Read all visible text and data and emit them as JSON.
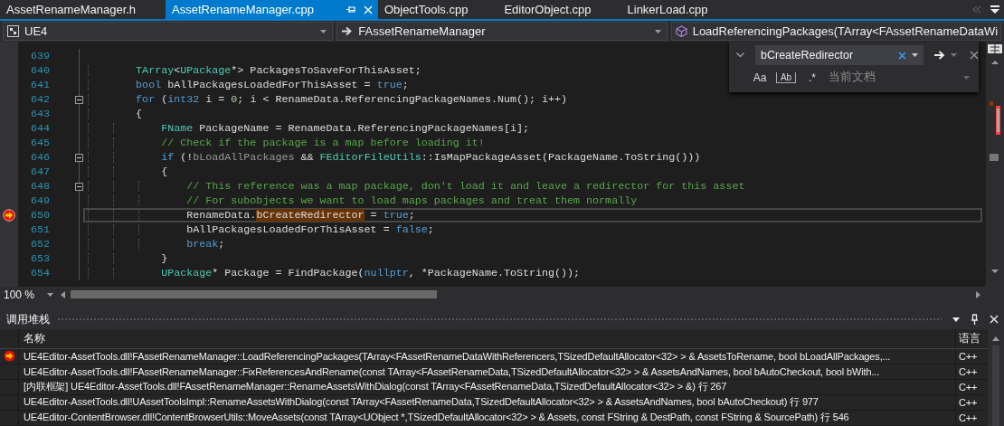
{
  "tabs": [
    {
      "label": "AssetRenameManager.h",
      "selected": false
    },
    {
      "label": "AssetRenameManager.cpp",
      "selected": true
    },
    {
      "label": "ObjectTools.cpp",
      "selected": false
    },
    {
      "label": "EditorObject.cpp",
      "selected": false
    },
    {
      "label": "LinkerLoad.cpp",
      "selected": false
    }
  ],
  "navigation": {
    "project": "UE4",
    "scope": "FAssetRenameManager",
    "member": "LoadReferencingPackages(TArray<FAssetRenameDataWi"
  },
  "find": {
    "value": "bCreateRedirector",
    "scope": "当前文档",
    "options": [
      {
        "kind": "case",
        "label": "Aa",
        "on": false
      },
      {
        "kind": "word",
        "label": "Ab",
        "on": false
      },
      {
        "kind": "regex",
        "label": ".*",
        "on": false
      }
    ]
  },
  "code": {
    "lines": [
      {
        "number": "639",
        "collapsible": false,
        "current": false
      },
      {
        "number": "640",
        "collapsible": false,
        "current": false,
        "segments": [
          {
            "kind": "type",
            "text": "        TArray"
          },
          {
            "kind": "plain",
            "text": "<"
          },
          {
            "kind": "type",
            "text": "UPackage"
          },
          {
            "kind": "plain",
            "text": "*> PackagesToSaveForThisAsset;"
          }
        ]
      },
      {
        "number": "641",
        "collapsible": false,
        "current": false,
        "segments": [
          {
            "kind": "keyword",
            "text": "        bool"
          },
          {
            "kind": "plain",
            "text": " bAllPackagesLoadedForThisAsset = "
          },
          {
            "kind": "keyword",
            "text": "true"
          },
          {
            "kind": "plain",
            "text": ";"
          }
        ]
      },
      {
        "number": "642",
        "collapsible": true,
        "current": false,
        "segments": [
          {
            "kind": "keyword",
            "text": "        for"
          },
          {
            "kind": "plain",
            "text": " ("
          },
          {
            "kind": "keyword",
            "text": "int32"
          },
          {
            "kind": "plain",
            "text": " i = "
          },
          {
            "kind": "number",
            "text": "0"
          },
          {
            "kind": "plain",
            "text": "; i < RenameData.ReferencingPackageNames.Num(); i++)"
          }
        ]
      },
      {
        "number": "643",
        "collapsible": false,
        "current": false,
        "segments": [
          {
            "kind": "plain",
            "text": "        {"
          }
        ]
      },
      {
        "number": "644",
        "collapsible": false,
        "current": false,
        "segments": [
          {
            "kind": "type",
            "text": "            FName"
          },
          {
            "kind": "plain",
            "text": " PackageName = RenameData.ReferencingPackageNames[i];"
          }
        ]
      },
      {
        "number": "645",
        "collapsible": false,
        "current": false,
        "segments": [
          {
            "kind": "comment",
            "text": "            // Check if the package is a map before loading it!"
          }
        ]
      },
      {
        "number": "646",
        "collapsible": true,
        "current": false,
        "segments": [
          {
            "kind": "keyword",
            "text": "            if"
          },
          {
            "kind": "plain",
            "text": " (!"
          },
          {
            "kind": "param",
            "text": "bLoadAllPackages"
          },
          {
            "kind": "plain",
            "text": " && "
          },
          {
            "kind": "type",
            "text": "FEditorFileUtils"
          },
          {
            "kind": "plain",
            "text": "::IsMapPackageAsset(PackageName.ToString()))"
          }
        ]
      },
      {
        "number": "647",
        "collapsible": false,
        "current": false,
        "segments": [
          {
            "kind": "plain",
            "text": "            {"
          }
        ]
      },
      {
        "number": "648",
        "collapsible": true,
        "current": false,
        "segments": [
          {
            "kind": "comment",
            "text": "                // This reference was a map package, don't load it and leave a redirector for this asset"
          }
        ]
      },
      {
        "number": "649",
        "collapsible": false,
        "current": false,
        "segments": [
          {
            "kind": "comment",
            "text": "                // For subobjects we want to load maps packages and treat them normally"
          }
        ]
      },
      {
        "number": "650",
        "collapsible": false,
        "current": true,
        "segments": [
          {
            "kind": "plain",
            "text": "                RenameData."
          },
          {
            "kind": "match",
            "text": "bCreateRedirector"
          },
          {
            "kind": "plain",
            "text": " = "
          },
          {
            "kind": "keyword",
            "text": "true"
          },
          {
            "kind": "plain",
            "text": ";"
          }
        ]
      },
      {
        "number": "651",
        "collapsible": false,
        "current": false,
        "segments": [
          {
            "kind": "plain",
            "text": "                bAllPackagesLoadedForThisAsset = "
          },
          {
            "kind": "keyword",
            "text": "false"
          },
          {
            "kind": "plain",
            "text": ";"
          }
        ]
      },
      {
        "number": "652",
        "collapsible": false,
        "current": false,
        "segments": [
          {
            "kind": "keyword",
            "text": "                break"
          },
          {
            "kind": "plain",
            "text": ";"
          }
        ]
      },
      {
        "number": "653",
        "collapsible": false,
        "current": false,
        "segments": [
          {
            "kind": "plain",
            "text": "            }"
          }
        ]
      },
      {
        "number": "654",
        "collapsible": false,
        "current": false,
        "segments": [
          {
            "kind": "type",
            "text": "            UPackage"
          },
          {
            "kind": "plain",
            "text": "* Package = FindPackage("
          },
          {
            "kind": "keyword",
            "text": "nullptr"
          },
          {
            "kind": "plain",
            "text": ", *PackageName.ToString());"
          }
        ]
      }
    ],
    "zoom": "100 %"
  },
  "callstack": {
    "title": "调用堆栈",
    "columns": [
      "名称",
      "语言"
    ],
    "rows": [
      {
        "name": "UE4Editor-AssetTools.dll!FAssetRenameManager::LoadReferencingPackages(TArray<FAssetRenameDataWithReferencers,TSizedDefaultAllocator<32> > & AssetsToRename, bool bLoadAllPackages,...",
        "language": "C++",
        "current": true
      },
      {
        "name": "UE4Editor-AssetTools.dll!FAssetRenameManager::FixReferencesAndRename(const TArray<FAssetRenameData,TSizedDefaultAllocator<32> > & AssetsAndNames, bool bAutoCheckout, bool bWith...",
        "language": "C++",
        "current": false
      },
      {
        "name": "[内联框架] UE4Editor-AssetTools.dll!FAssetRenameManager::RenameAssetsWithDialog(const TArray<FAssetRenameData,TSizedDefaultAllocator<32> > &) 行 267",
        "language": "C++",
        "current": false
      },
      {
        "name": "UE4Editor-AssetTools.dll!UAssetToolsImpl::RenameAssetsWithDialog(const TArray<FAssetRenameData,TSizedDefaultAllocator<32> > & AssetsAndNames, bool bAutoCheckout) 行 977",
        "language": "C++",
        "current": false
      },
      {
        "name": "UE4Editor-ContentBrowser.dll!ContentBrowserUtils::MoveAssets(const TArray<UObject *,TSizedDefaultAllocator<32> > & Assets, const FString & DestPath, const FString & SourcePath) 行 546",
        "language": "C++",
        "current": false
      }
    ]
  }
}
